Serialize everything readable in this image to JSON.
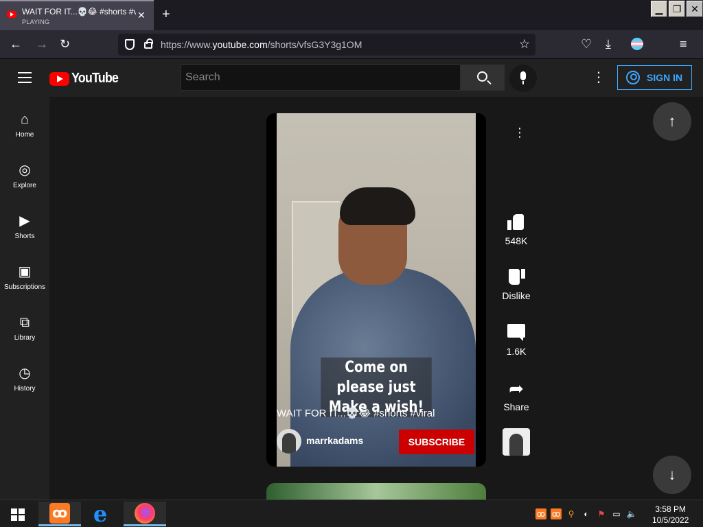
{
  "browser": {
    "tab": {
      "title": "WAIT FOR IT...💀😂 #shorts #viral",
      "status": "PLAYING",
      "close": "✕"
    },
    "new_tab": "+",
    "url": {
      "prefix": "https://www.",
      "host": "youtube.com",
      "path": "/shorts/vfsG3Y3g1OM"
    },
    "window_buttons": {
      "minimize": "▁",
      "restore": "❐",
      "close": "✕"
    }
  },
  "masthead": {
    "logo_text": "YouTube",
    "search_placeholder": "Search",
    "sign_in": "SIGN IN"
  },
  "sidebar": {
    "items": [
      {
        "label": "Home",
        "icon": "home-icon"
      },
      {
        "label": "Explore",
        "icon": "compass-icon"
      },
      {
        "label": "Shorts",
        "icon": "shorts-icon"
      },
      {
        "label": "Subscriptions",
        "icon": "subscriptions-icon"
      },
      {
        "label": "Library",
        "icon": "library-icon"
      },
      {
        "label": "History",
        "icon": "history-icon"
      }
    ]
  },
  "video": {
    "caption_line1": "Come on please just",
    "caption_line2": "Make a wish!",
    "title": "WAIT FOR IT...💀😂 #shorts #viral",
    "channel": "marrkadams",
    "subscribe": "SUBSCRIBE"
  },
  "actions": {
    "likes": "548K",
    "dislike": "Dislike",
    "comments": "1.6K",
    "share": "Share"
  },
  "nav": {
    "up": "↑",
    "down": "↓"
  },
  "taskbar": {
    "time": "3:58 PM",
    "date": "10/5/2022"
  },
  "colors": {
    "accent": "#3ea6ff",
    "subscribe": "#cc0000",
    "logo": "#ff0000"
  }
}
